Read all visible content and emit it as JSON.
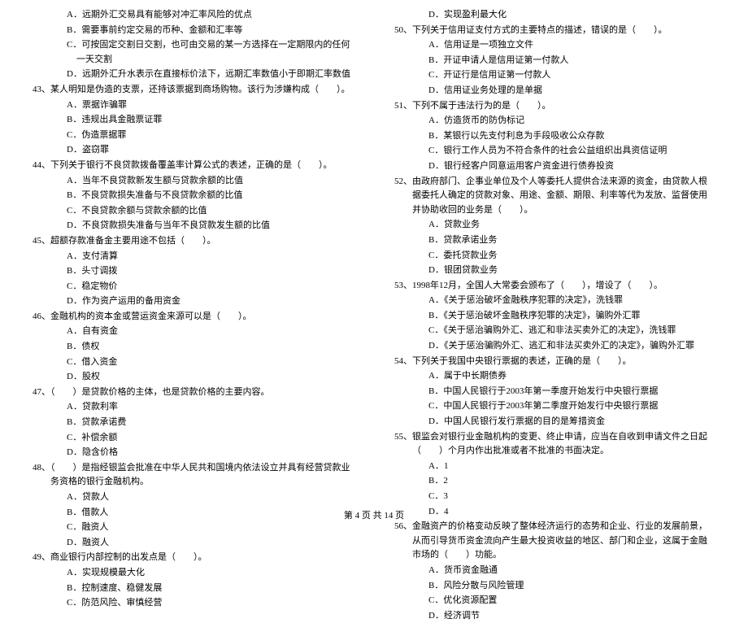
{
  "left": {
    "q42_opts": [
      "A．远期外汇交易具有能够对冲汇率风险的优点",
      "B．需要事前约定交易的币种、金额和汇率等",
      "C．可按固定交割日交割，也可由交易的某一方选择在一定期限内的任何一天交割",
      "D．远期外汇升水表示在直接标价法下，远期汇率数值小于即期汇率数值"
    ],
    "q43": "43、某人明知是伪造的支票，还持该票据到商场购物。该行为涉嫌构成（　　）。",
    "q43_opts": [
      "A．票据诈骗罪",
      "B．违规出具金融票证罪",
      "C．伪造票据罪",
      "D．盗窃罪"
    ],
    "q44": "44、下列关于银行不良贷款拨备覆盖率计算公式的表述，正确的是（　　）。",
    "q44_opts": [
      "A．当年不良贷款新发生额与贷款余额的比值",
      "B．不良贷款损失准备与不良贷款余额的比值",
      "C．不良贷款余额与贷款余额的比值",
      "D．不良贷款损失准备与当年不良贷款发生额的比值"
    ],
    "q45": "45、超额存款准备金主要用途不包括（　　）。",
    "q45_opts": [
      "A．支付清算",
      "B．头寸调拨",
      "C．稳定物价",
      "D．作为资产运用的备用资金"
    ],
    "q46": "46、金融机构的资本金或营运资金来源可以是（　　）。",
    "q46_opts": [
      "A．自有资金",
      "B．债权",
      "C．借入资金",
      "D．股权"
    ],
    "q47": "47、（　　）是贷款价格的主体，也是贷款价格的主要内容。",
    "q47_opts": [
      "A．贷款利率",
      "B．贷款承诺费",
      "C．补偿余额",
      "D．隐含价格"
    ],
    "q48": "48、（　　）是指经银监会批准在中华人民共和国境内依法设立并具有经营贷款业务资格的银行金融机构。",
    "q48_opts": [
      "A．贷款人",
      "B．借款人",
      "C．融资人",
      "D．融资人"
    ],
    "q49": "49、商业银行内部控制的出发点是（　　）。",
    "q49_opts": [
      "A．实现规模最大化",
      "B．控制速度、稳健发展",
      "C．防范风险、审慎经营"
    ]
  },
  "right": {
    "q49_d": "D．实现盈利最大化",
    "q50": "50、下列关于信用证支付方式的主要特点的描述，错误的是（　　）。",
    "q50_opts": [
      "A．信用证是一项独立文件",
      "B．开证申请人是信用证第一付款人",
      "C．开证行是信用证第一付款人",
      "D．信用证业务处理的是单据"
    ],
    "q51": "51、下列不属于违法行为的是（　　）。",
    "q51_opts": [
      "A．仿造货币的防伪标记",
      "B．某银行以先支付利息为手段吸收公众存款",
      "C．银行工作人员为不符合条件的社会公益组织出具资信证明",
      "D．银行经客户同意运用客户资金进行债券投资"
    ],
    "q52": "52、由政府部门、企事业单位及个人等委托人提供合法来源的资金，由贷款人根据委托人确定的贷款对象、用途、金额、期限、利率等代为发放、监督使用并协助收回的业务是（　　）。",
    "q52_opts": [
      "A．贷款业务",
      "B．贷款承诺业务",
      "C．委托贷款业务",
      "D．银团贷款业务"
    ],
    "q53": "53、1998年12月，全国人大常委会颁布了（　　），增设了（　　）。",
    "q53_opts": [
      "A．《关于惩治破坏金融秩序犯罪的决定》，洗钱罪",
      "B．《关于惩治破坏金融秩序犯罪的决定》，骗购外汇罪",
      "C．《关于惩治骗购外汇、逃汇和非法买卖外汇的决定》，洗钱罪",
      "D．《关于惩治骗购外汇、逃汇和非法买卖外汇的决定》，骗购外汇罪"
    ],
    "q54": "54、下列关于我国中央银行票据的表述，正确的是（　　）。",
    "q54_opts": [
      "A．属于中长期债券",
      "B．中国人民银行于2003年第一季度开始发行中央银行票据",
      "C．中国人民银行于2003年第二季度开始发行中央银行票据",
      "D．中国人民银行发行票据的目的是筹措资金"
    ],
    "q55": "55、银监会对银行业金融机构的变更、终止申请，应当在自收到申请文件之日起（　　）个月内作出批准或者不批准的书面决定。",
    "q55_opts": [
      "A．1",
      "B．2",
      "C．3",
      "D．4"
    ],
    "q56": "56、金融资产的价格变动反映了整体经济运行的态势和企业、行业的发展前景，从而引导货币资金流向产生最大投资收益的地区、部门和企业，这属于金融市场的（　　）功能。",
    "q56_opts": [
      "A．货币资金融通",
      "B．风险分散与风险管理",
      "C．优化资源配置",
      "D．经济调节"
    ]
  },
  "footer": "第 4 页 共 14 页"
}
